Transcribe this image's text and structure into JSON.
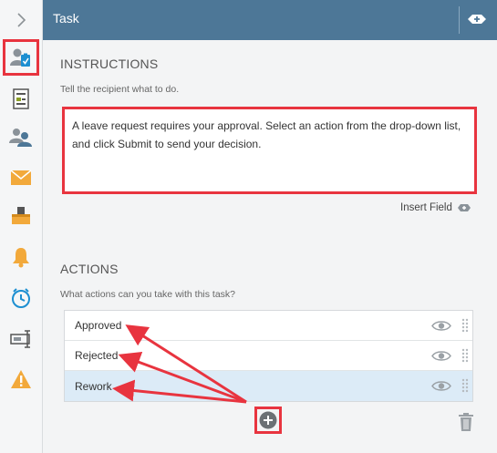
{
  "header": {
    "title": "Task"
  },
  "rail": {
    "items": [
      {
        "icon": "chevron-right-icon"
      },
      {
        "icon": "user-task-icon",
        "highlighted": true
      },
      {
        "icon": "form-document-icon"
      },
      {
        "icon": "participants-icon"
      },
      {
        "icon": "email-icon"
      },
      {
        "icon": "inbox-tray-icon"
      },
      {
        "icon": "notification-bell-icon"
      },
      {
        "icon": "timer-icon"
      },
      {
        "icon": "text-field-icon"
      },
      {
        "icon": "warning-icon"
      }
    ]
  },
  "instructions": {
    "heading": "INSTRUCTIONS",
    "hint": "Tell the recipient what to do.",
    "text": "A leave request requires your approval. Select an action from the drop-down list, and click Submit to send your decision.",
    "insert_field_label": "Insert Field"
  },
  "actions": {
    "heading": "ACTIONS",
    "hint": "What actions can you take with this task?",
    "items": [
      {
        "label": "Approved",
        "selected": false
      },
      {
        "label": "Rejected",
        "selected": false
      },
      {
        "label": "Rework",
        "selected": true
      }
    ]
  },
  "colors": {
    "header": "#4d7797",
    "highlight": "#e8343f",
    "selected_row": "#dcebf7",
    "accent_orange": "#f2a93b",
    "accent_blue": "#1d8fd1"
  }
}
